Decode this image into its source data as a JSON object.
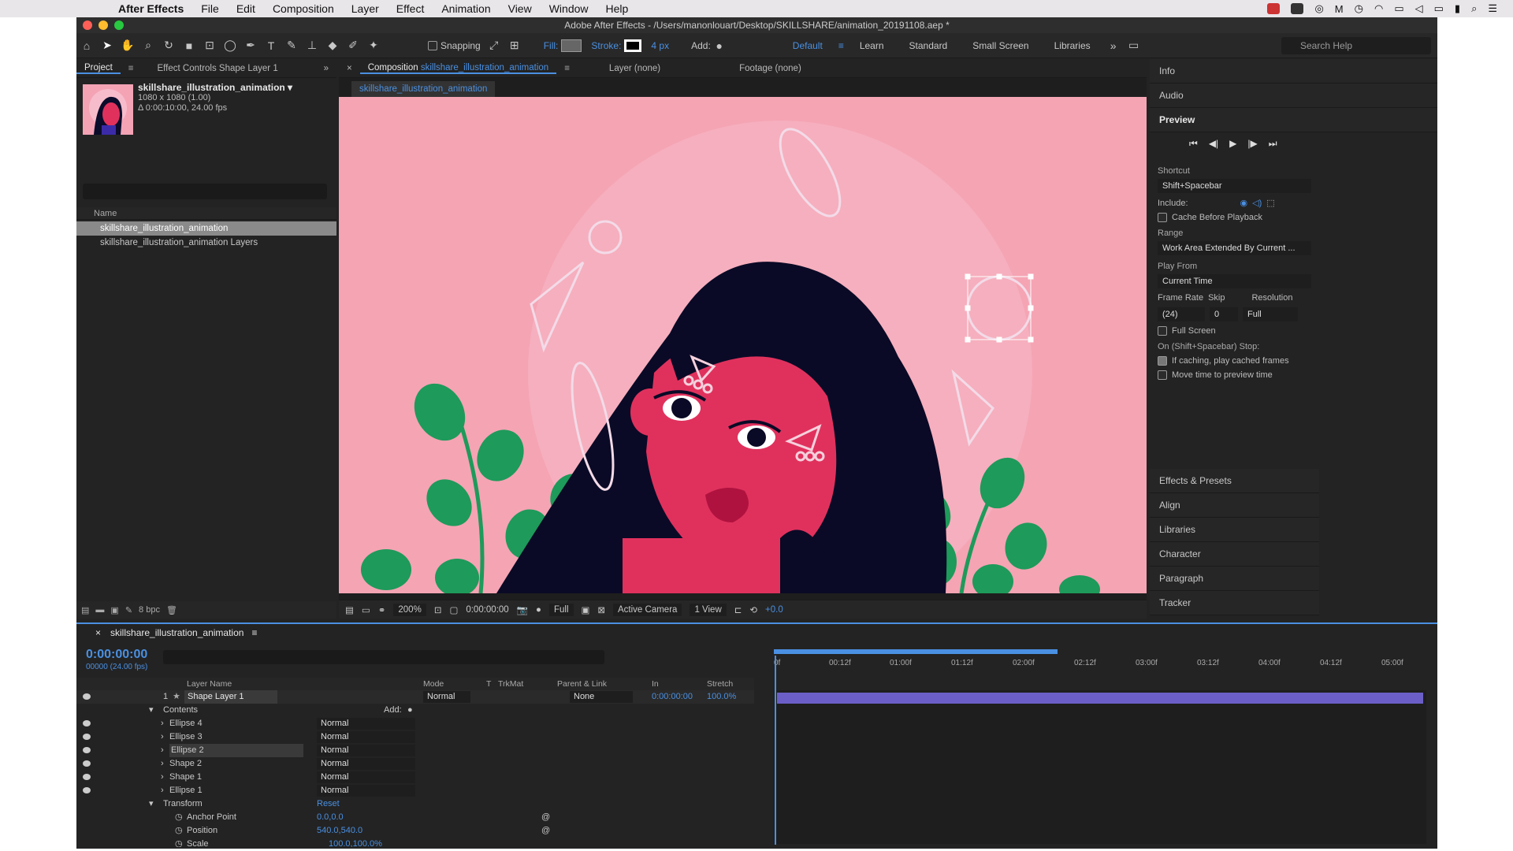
{
  "menubar": {
    "app_name": "After Effects",
    "items": [
      "File",
      "Edit",
      "Composition",
      "Layer",
      "Effect",
      "Animation",
      "View",
      "Window",
      "Help"
    ]
  },
  "window": {
    "title": "Adobe After Effects - /Users/manonlouart/Desktop/SKILLSHARE/animation_20191108.aep *"
  },
  "toolbar": {
    "snapping": "Snapping",
    "fill": "Fill:",
    "stroke": "Stroke:",
    "stroke_width": "4 px",
    "add": "Add:",
    "workspaces": [
      "Default",
      "Learn",
      "Standard",
      "Small Screen",
      "Libraries"
    ],
    "active_workspace": "Default",
    "search_placeholder": "Search Help"
  },
  "project": {
    "tab_project": "Project",
    "tab_effect_controls": "Effect Controls Shape Layer 1",
    "comp_name": "skillshare_illustration_animation ▾",
    "comp_size": "1080 x 1080 (1.00)",
    "comp_duration": "Δ 0:00:10:00, 24.00 fps",
    "column_name": "Name",
    "items": [
      "skillshare_illustration_animation",
      "skillshare_illustration_animation Layers"
    ],
    "bpc": "8 bpc"
  },
  "composition": {
    "tab_label": "Composition",
    "tab_comp": "skillshare_illustration_animation",
    "layer_tab": "Layer (none)",
    "footage_tab": "Footage (none)",
    "subtab": "skillshare_illustration_animation",
    "zoom": "200%",
    "time": "0:00:00:00",
    "resolution": "Full",
    "camera": "Active Camera",
    "views": "1 View",
    "exposure": "+0.0"
  },
  "right": {
    "info": "Info",
    "audio": "Audio",
    "preview": "Preview",
    "shortcut_label": "Shortcut",
    "shortcut": "Shift+Spacebar",
    "include": "Include:",
    "cache": "Cache Before Playback",
    "range_label": "Range",
    "range": "Work Area Extended By Current ...",
    "play_from_label": "Play From",
    "play_from": "Current Time",
    "frame_rate_label": "Frame Rate",
    "skip_label": "Skip",
    "resolution_label": "Resolution",
    "frame_rate": "(24)",
    "skip": "0",
    "resolution": "Full",
    "full_screen": "Full Screen",
    "stop_label": "On (Shift+Spacebar) Stop:",
    "if_caching": "If caching, play cached frames",
    "move_time": "Move time to preview time",
    "sections": [
      "Effects & Presets",
      "Align",
      "Libraries",
      "Character",
      "Paragraph",
      "Tracker"
    ]
  },
  "timeline": {
    "comp_tab": "skillshare_illustration_animation",
    "time": "0:00:00:00",
    "time_sub": "00000 (24.00 fps)",
    "columns": {
      "layer_name": "Layer Name",
      "mode": "Mode",
      "t": "T",
      "trkmat": "TrkMat",
      "parent": "Parent & Link",
      "in": "In",
      "stretch": "Stretch"
    },
    "layer": {
      "num": "1",
      "name": "Shape Layer 1",
      "mode": "Normal",
      "parent": "None",
      "in": "0:00:00:00",
      "stretch": "100.0%"
    },
    "contents": "Contents",
    "add": "Add:",
    "shapes": [
      {
        "name": "Ellipse 4",
        "mode": "Normal"
      },
      {
        "name": "Ellipse 3",
        "mode": "Normal"
      },
      {
        "name": "Ellipse 2",
        "mode": "Normal"
      },
      {
        "name": "Shape 2",
        "mode": "Normal"
      },
      {
        "name": "Shape 1",
        "mode": "Normal"
      },
      {
        "name": "Ellipse 1",
        "mode": "Normal"
      }
    ],
    "transform": "Transform",
    "reset": "Reset",
    "anchor_point": {
      "label": "Anchor Point",
      "value": "0.0,0.0"
    },
    "position": {
      "label": "Position",
      "value": "540.0,540.0"
    },
    "scale": {
      "label": "Scale",
      "value": "100.0,100.0%"
    },
    "ruler": [
      "0f",
      "00:12f",
      "01:00f",
      "01:12f",
      "02:00f",
      "02:12f",
      "03:00f",
      "03:12f",
      "04:00f",
      "04:12f",
      "05:00f"
    ]
  }
}
